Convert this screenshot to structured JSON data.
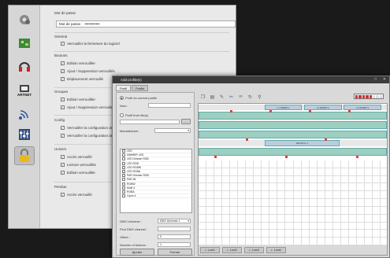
{
  "settings_window": {
    "password_section": "Mot de passe",
    "password_label": "Mot de passe :",
    "password_value": "••••••••••••",
    "sections": [
      {
        "title": "Général",
        "items": [
          "Verrouiller la fermeture du logiciel"
        ]
      },
      {
        "title": "Boutons",
        "items": [
          "Edition verrouillée",
          "Ajout / Suppression verrouillés",
          "Déplacement verrouillé"
        ]
      },
      {
        "title": "Groupes",
        "items": [
          "Edition verrouillée",
          "Ajout / Suppression verrouillés"
        ]
      },
      {
        "title": "Config",
        "items": [
          "Verrouiller la configuration des préf",
          "Verrouiller la configuration des dcl"
        ]
      },
      {
        "title": "Univers",
        "items": [
          "Accès verrouillé",
          "Lecture verrouillée",
          "Edition verrouillée"
        ]
      },
      {
        "title": "Pendue",
        "items": [
          "Accès verrouillé"
        ]
      }
    ],
    "sidebar_icons": [
      "gear-icon",
      "board-icon",
      "audio-icon",
      "artnet-icon",
      "wireless-icon",
      "faders-icon",
      "lock-icon"
    ],
    "artnet_text": "ARTNET"
  },
  "profile_window": {
    "title": "Add profile(s)",
    "tabs": [
      "Profil",
      "Profils"
    ],
    "from_current_label": "Profil du current profile",
    "name_label": "Nom :",
    "from_file_label": "Profil from file(s)",
    "manufacturer_label": "Manufacturer :",
    "fixtures": [
      "LED",
      "DIMMER LED",
      "LED Dimmer RGB",
      "LED RGB",
      "LED RGBW",
      "LED RGBA",
      "PAR Dimmer RGB",
      "PAR 56",
      "RGBW",
      "Multi 4",
      "RGBA",
      "Cyclo 4"
    ],
    "dmx_universe_label": "DMX Universe :",
    "dmx_universe_value": "DMX Universe 1",
    "first_address_label": "First DMX channel :",
    "offset_label": "Offset :",
    "offset_value": "0",
    "count_label": "Number of fixtures :",
    "count_value": "1",
    "ok_label": "Ajouter",
    "cancel_label": "Fermer",
    "bottom_tabs": [
      "Lum1",
      "Lum2",
      "Lum3",
      "Lum4"
    ],
    "group_blocks": [
      "L1 RGBW 1",
      "L1 RGBW 2",
      "L1 RGBW 3"
    ],
    "track_label": "WashCyc 1"
  }
}
